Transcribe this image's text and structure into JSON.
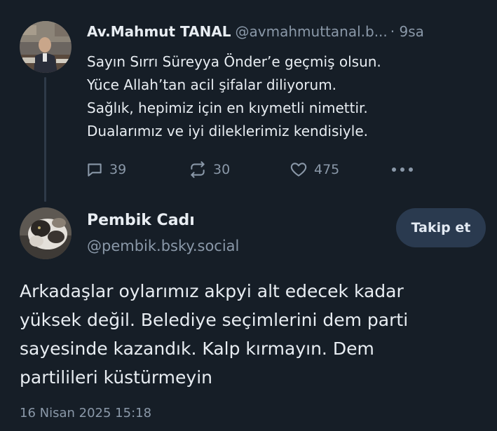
{
  "reply": {
    "author_name": "Av.Mahmut TANAL",
    "author_handle": "@avmahmuttanal.b...",
    "time": "· 9sa",
    "text_lines": [
      "Sayın Sırrı Süreyya Önder’e geçmiş olsun.",
      "Yüce Allah’tan acil şifalar diliyorum.",
      "Sağlık, hepimiz için en kıymetli nimettir.",
      "Dualarımız ve iyi dileklerimiz kendisiyle."
    ],
    "actions": {
      "reply_count": "39",
      "repost_count": "30",
      "like_count": "475",
      "reply_icon": "speech-bubble-icon",
      "repost_icon": "repost-arrows-icon",
      "like_icon": "heart-icon",
      "more_icon": "ellipsis-icon"
    }
  },
  "post": {
    "author_name": "Pembik Cadı",
    "author_handle": "@pembik.bsky.social",
    "follow_label": "Takip et",
    "text_lines": [
      "Arkadaşlar oylarımız akpyi alt edecek kadar",
      "yüksek değil. Belediye seçimlerini dem parti",
      "sayesinde kazandık. Kalp kırmayın. Dem",
      "partilileri küstürmeyin"
    ],
    "date": "16 Nisan 2025 15:18"
  },
  "colors": {
    "background": "#161e27",
    "text_primary": "#e8edf2",
    "text_secondary": "#8a98a8",
    "follow_button_bg": "#2a3a4f",
    "thread_line": "#2e3a48"
  }
}
